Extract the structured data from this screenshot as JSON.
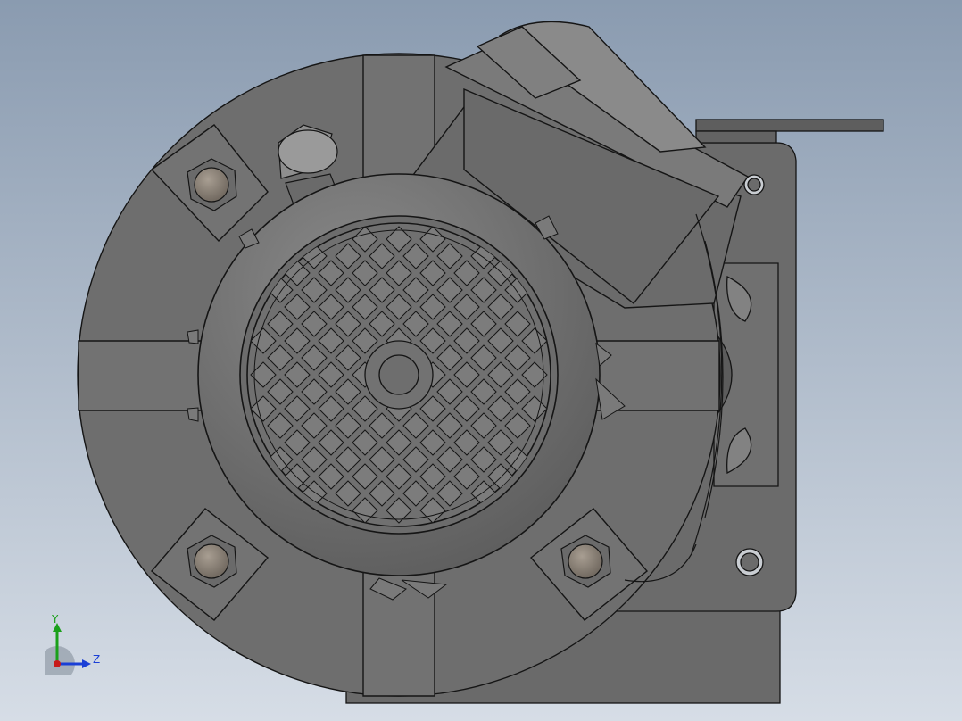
{
  "viewport": {
    "background_top": "#8a9bb0",
    "background_bottom": "#d6dde6"
  },
  "model": {
    "body_color": "#6e6e6e",
    "fan_cover_color": "#777777",
    "edge_color": "#151515",
    "bolt_color": "#8d8479"
  },
  "triad": {
    "y_label": "Y",
    "z_label": "Z",
    "y_color": "#1aa01a",
    "z_color": "#1a3fd6",
    "x_color": "#c81a1a"
  }
}
